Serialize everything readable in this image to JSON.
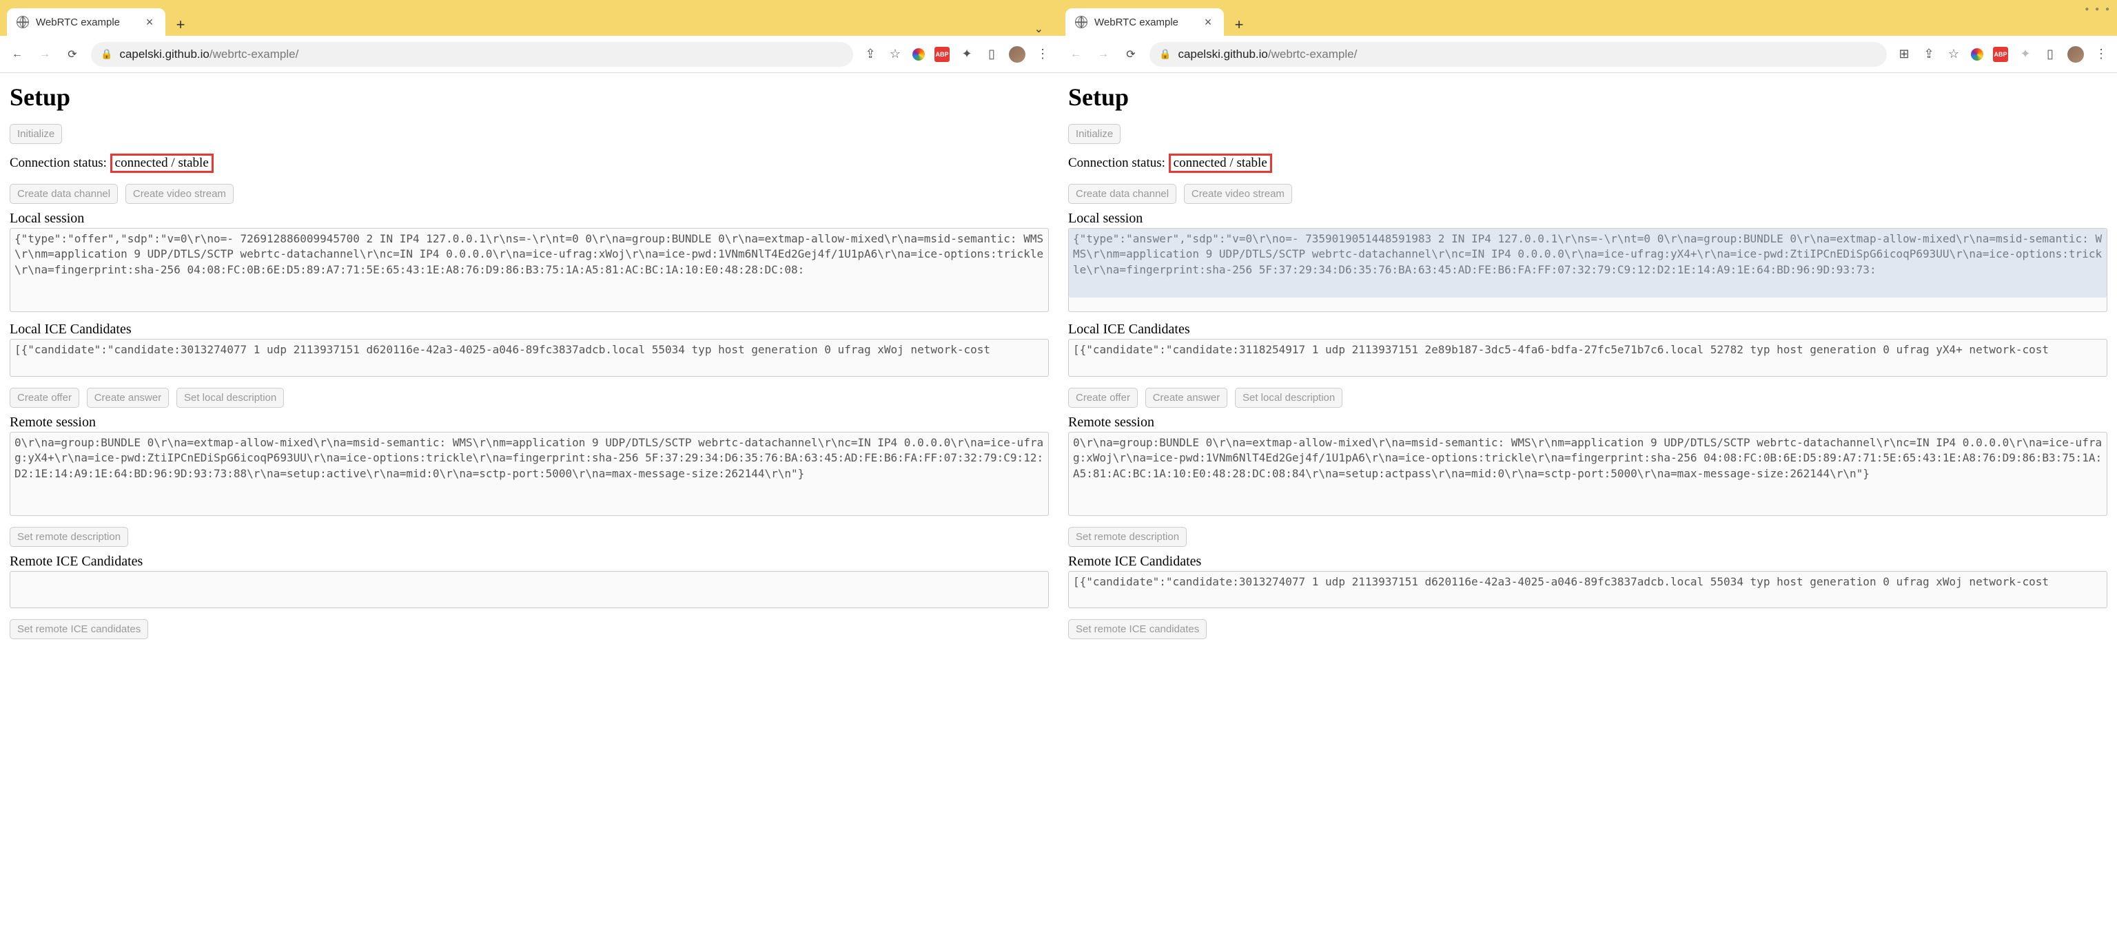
{
  "tab_title": "WebRTC example",
  "url_host": "capelski.github.io",
  "url_path": "/webrtc-example/",
  "left": {
    "heading": "Setup",
    "initialize_btn": "Initialize",
    "status_label": "Connection status:",
    "status_value": "connected / stable",
    "create_data_channel": "Create data channel",
    "create_video_stream": "Create video stream",
    "local_session_label": "Local session",
    "local_session_text": "{\"type\":\"offer\",\"sdp\":\"v=0\\r\\no=- 726912886009945700 2 IN IP4 127.0.0.1\\r\\ns=-\\r\\nt=0 0\\r\\na=group:BUNDLE 0\\r\\na=extmap-allow-mixed\\r\\na=msid-semantic: WMS\\r\\nm=application 9 UDP/DTLS/SCTP webrtc-datachannel\\r\\nc=IN IP4 0.0.0.0\\r\\na=ice-ufrag:xWoj\\r\\na=ice-pwd:1VNm6NlT4Ed2Gej4f/1U1pA6\\r\\na=ice-options:trickle\\r\\na=fingerprint:sha-256 04:08:FC:0B:6E:D5:89:A7:71:5E:65:43:1E:A8:76:D9:86:B3:75:1A:A5:81:AC:BC:1A:10:E0:48:28:DC:08:",
    "local_ice_label": "Local ICE Candidates",
    "local_ice_text": "[{\"candidate\":\"candidate:3013274077 1 udp 2113937151 d620116e-42a3-4025-a046-89fc3837adcb.local 55034 typ host generation 0 ufrag xWoj network-cost",
    "create_offer": "Create offer",
    "create_answer": "Create answer",
    "set_local_desc": "Set local description",
    "remote_session_label": "Remote session",
    "remote_session_text": "0\\r\\na=group:BUNDLE 0\\r\\na=extmap-allow-mixed\\r\\na=msid-semantic: WMS\\r\\nm=application 9 UDP/DTLS/SCTP webrtc-datachannel\\r\\nc=IN IP4 0.0.0.0\\r\\na=ice-ufrag:yX4+\\r\\na=ice-pwd:ZtiIPCnEDiSpG6icoqP693UU\\r\\na=ice-options:trickle\\r\\na=fingerprint:sha-256 5F:37:29:34:D6:35:76:BA:63:45:AD:FE:B6:FA:FF:07:32:79:C9:12:D2:1E:14:A9:1E:64:BD:96:9D:93:73:88\\r\\na=setup:active\\r\\na=mid:0\\r\\na=sctp-port:5000\\r\\na=max-message-size:262144\\r\\n\"}",
    "set_remote_desc": "Set remote description",
    "remote_ice_label": "Remote ICE Candidates",
    "remote_ice_text": "",
    "set_remote_ice": "Set remote ICE candidates"
  },
  "right": {
    "heading": "Setup",
    "initialize_btn": "Initialize",
    "status_label": "Connection status:",
    "status_value": "connected / stable",
    "create_data_channel": "Create data channel",
    "create_video_stream": "Create video stream",
    "local_session_label": "Local session",
    "local_session_text": "{\"type\":\"answer\",\"sdp\":\"v=0\\r\\no=- 7359019051448591983 2 IN IP4 127.0.0.1\\r\\ns=-\\r\\nt=0 0\\r\\na=group:BUNDLE 0\\r\\na=extmap-allow-mixed\\r\\na=msid-semantic: WMS\\r\\nm=application 9 UDP/DTLS/SCTP webrtc-datachannel\\r\\nc=IN IP4 0.0.0.0\\r\\na=ice-ufrag:yX4+\\r\\na=ice-pwd:ZtiIPCnEDiSpG6icoqP693UU\\r\\na=ice-options:trickle\\r\\na=fingerprint:sha-256 5F:37:29:34:D6:35:76:BA:63:45:AD:FE:B6:FA:FF:07:32:79:C9:12:D2:1E:14:A9:1E:64:BD:96:9D:93:73:",
    "local_ice_label": "Local ICE Candidates",
    "local_ice_text": "[{\"candidate\":\"candidate:3118254917 1 udp 2113937151 2e89b187-3dc5-4fa6-bdfa-27fc5e71b7c6.local 52782 typ host generation 0 ufrag yX4+ network-cost",
    "create_offer": "Create offer",
    "create_answer": "Create answer",
    "set_local_desc": "Set local description",
    "remote_session_label": "Remote session",
    "remote_session_text": "0\\r\\na=group:BUNDLE 0\\r\\na=extmap-allow-mixed\\r\\na=msid-semantic: WMS\\r\\nm=application 9 UDP/DTLS/SCTP webrtc-datachannel\\r\\nc=IN IP4 0.0.0.0\\r\\na=ice-ufrag:xWoj\\r\\na=ice-pwd:1VNm6NlT4Ed2Gej4f/1U1pA6\\r\\na=ice-options:trickle\\r\\na=fingerprint:sha-256 04:08:FC:0B:6E:D5:89:A7:71:5E:65:43:1E:A8:76:D9:86:B3:75:1A:A5:81:AC:BC:1A:10:E0:48:28:DC:08:84\\r\\na=setup:actpass\\r\\na=mid:0\\r\\na=sctp-port:5000\\r\\na=max-message-size:262144\\r\\n\"}",
    "set_remote_desc": "Set remote description",
    "remote_ice_label": "Remote ICE Candidates",
    "remote_ice_text": "[{\"candidate\":\"candidate:3013274077 1 udp 2113937151 d620116e-42a3-4025-a046-89fc3837adcb.local 55034 typ host generation 0 ufrag xWoj network-cost",
    "set_remote_ice": "Set remote ICE candidates"
  }
}
